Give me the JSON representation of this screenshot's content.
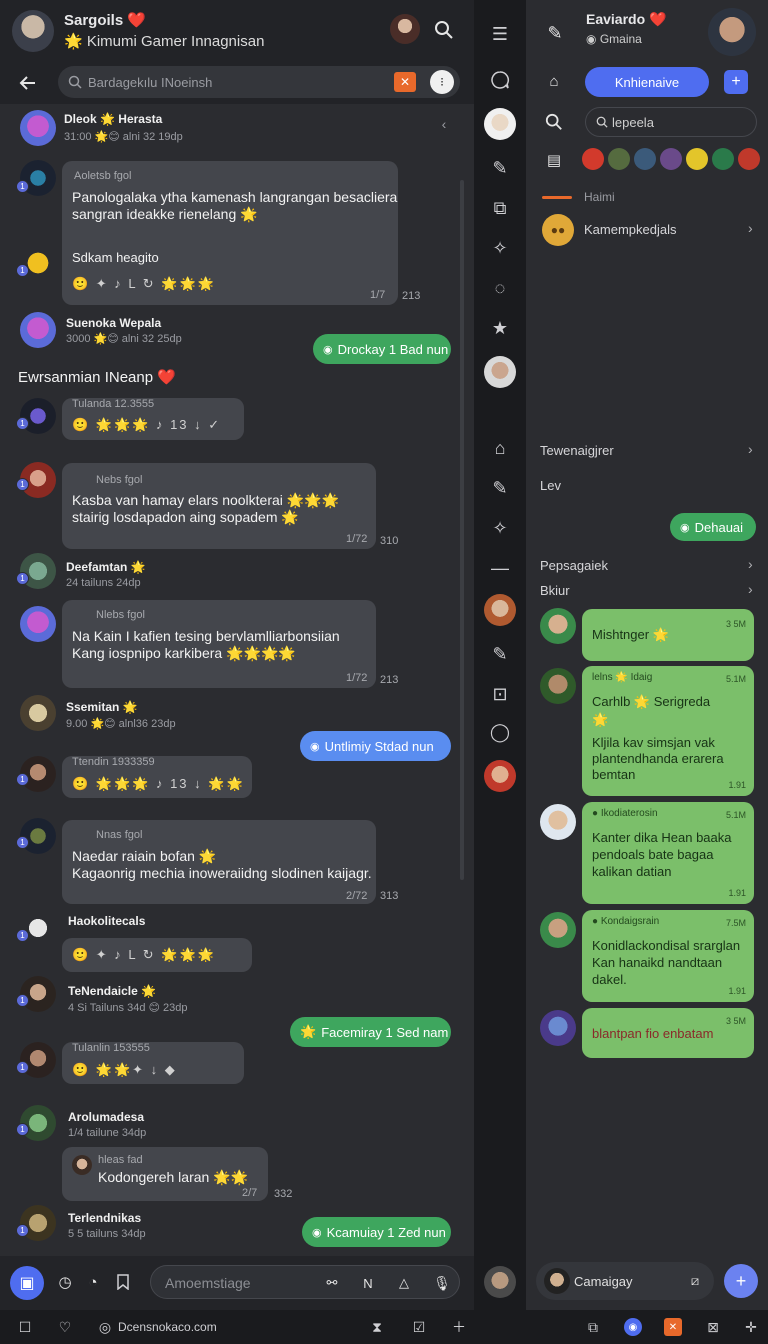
{
  "left": {
    "header": {
      "name": "Sargoils ❤️",
      "subtitle": "🌟 Kimumi Gamer Innagnisan"
    },
    "search": {
      "placeholder": "Bardagekılu INoeinsh"
    },
    "messages": [
      {
        "name": "Dleok 🌟 Herasta",
        "meta": "31:00 🌟😊 alni 32 19dp"
      },
      {
        "tag": "Aoletsb fgol",
        "text1": "Panologalaka ytha kamenash langrangan besacliera",
        "text2": "sangran ideakke rienelang 🌟",
        "text3": "Sdkam heagito",
        "reacts": "🙂 ✦  ♪ L  ↻ 🌟🌟🌟",
        "count": "1/7",
        "num": "213"
      },
      {
        "name": "Suenoka Wepala",
        "meta": "3000 🌟😊 alni 32 25dp",
        "pill": "Drockay 1 Bad nun"
      },
      {
        "section": "Ewrsanmian INeanp ❤️"
      },
      {
        "tag": "Tulanda 12.3555",
        "reacts": "🙂 🌟🌟🌟  ♪ 13  ↓ ✓"
      },
      {
        "tag": "Nebs fgol",
        "text1": "Kasba van hamay elars noolkterai 🌟🌟🌟",
        "text2": "stairig losdapadon aing sopadem 🌟",
        "count": "1/72",
        "num": "310"
      },
      {
        "name": "Deefamtan 🌟",
        "meta": "24 tailuns 24dp"
      },
      {
        "tag": "Nlebs fgol",
        "text1": "Na Kain I kafien tesing bervlamlliarbonsiian",
        "text2": "Kang iospnipo karkibera 🌟🌟🌟🌟",
        "count": "1/72",
        "num": "213"
      },
      {
        "name": "Ssemitan 🌟",
        "meta": "9.00 🌟😊 alnl36 23dp",
        "pill": "Untlimiy Stdad nun"
      },
      {
        "tag": "Ttendin 1933359",
        "reacts": "🙂 🌟🌟🌟  ♪ 13  ↓ 🌟🌟"
      },
      {
        "tag": "Nnas fgol",
        "text1": "Naedar raiain bofan 🌟",
        "text2": "Kagaonrig mechia inoweraiidng slodinen kaijagr.",
        "count": "2/72",
        "num": "313"
      },
      {
        "name": "Haokolitecals",
        "reacts": "🙂 ✦  ♪ L  ↻ 🌟🌟🌟"
      },
      {
        "name": "TeNendaicle 🌟",
        "meta": "4 Si Tailuns 34d 😊 23dp",
        "pill": "Facemiray 1 Sed nam"
      },
      {
        "tag": "Tulanlin 153555",
        "reacts": "🙂 🌟🌟✦  ↓ ◆"
      },
      {
        "name": "Arolumadesa",
        "meta": "1/4 tailune 34dp"
      },
      {
        "tag": "hleas fad",
        "text1": "Kodongereh laran 🌟🌟",
        "count": "2/7",
        "num": "332"
      },
      {
        "name": "Terlendnikas",
        "meta": "5 5 tailuns 34dp",
        "pill": "Kcamuiay 1 Zed nun"
      }
    ],
    "composer": {
      "placeholder": "Amoemstiage"
    }
  },
  "right": {
    "header": {
      "name": "Eaviardo ❤️",
      "subtitle": "Gmaina"
    },
    "primary_button": "Knhienaive",
    "search": "lepeela",
    "section_label": "Haimi",
    "row1": "Kamempkedjals",
    "row2": "Tewenaigjrer",
    "row3": "Lev",
    "pill": "Dehauai",
    "row4": "Pepsagaiek",
    "row5": "Bkiur",
    "cards": [
      {
        "text": "Mishtnger 🌟",
        "time": "3 5M"
      },
      {
        "name": "lelns 🌟 Idaig",
        "text1": "Carhlb 🌟 Serigreda",
        "text2": "🌟",
        "text3": "Kljila kav simsjan vak",
        "text4": "plantendhanda erarera",
        "text5": "bemtan",
        "time": "5.1M",
        "time2": "1.91"
      },
      {
        "name": "● Ikodiaterosin",
        "text1": "Kanter dika Hean baaka",
        "text2": "pendoals bate bagaa",
        "text3": "kalikan datian",
        "time": "5.1M",
        "time2": "1.91"
      },
      {
        "name": "● Kondaigsrain",
        "text1": "Konidlackondisal srarglan",
        "text2": "Kan hanaikd nandtaan",
        "text3": "dakel.",
        "time": "7.5M",
        "time2": "1.91"
      },
      {
        "text": "blantpan fio enbatam",
        "time": "3 5M"
      }
    ],
    "composer": "Camaigay"
  },
  "bottom": {
    "label": "Dcensnokaco.com"
  }
}
